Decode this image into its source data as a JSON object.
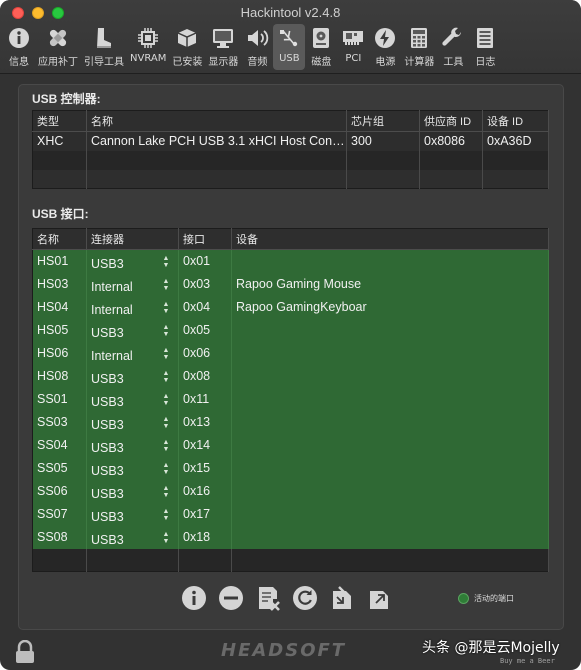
{
  "window": {
    "title": "Hackintool v2.4.8"
  },
  "toolbar": {
    "items": [
      {
        "label": "信息",
        "icon": "info-icon"
      },
      {
        "label": "应用补丁",
        "icon": "bandage-icon"
      },
      {
        "label": "引导工具",
        "icon": "boot-icon"
      },
      {
        "label": "NVRAM",
        "icon": "chip-icon"
      },
      {
        "label": "已安装",
        "icon": "box-icon"
      },
      {
        "label": "显示器",
        "icon": "monitor-icon"
      },
      {
        "label": "音频",
        "icon": "speaker-icon"
      },
      {
        "label": "USB",
        "icon": "usb-icon",
        "active": true
      },
      {
        "label": "磁盘",
        "icon": "disk-icon"
      },
      {
        "label": "PCI",
        "icon": "pci-card-icon"
      },
      {
        "label": "电源",
        "icon": "power-bolt-icon"
      },
      {
        "label": "计算器",
        "icon": "calculator-icon"
      },
      {
        "label": "工具",
        "icon": "wrench-icon"
      },
      {
        "label": "日志",
        "icon": "log-icon"
      }
    ]
  },
  "controllers": {
    "title": "USB 控制器:",
    "columns": [
      "类型",
      "名称",
      "芯片组",
      "供应商 ID",
      "设备 ID"
    ],
    "rows": [
      [
        "XHC",
        "Cannon Lake PCH USB 3.1 xHCI Host Controller",
        "300",
        "0x8086",
        "0xA36D"
      ]
    ]
  },
  "ports": {
    "title": "USB 接口:",
    "columns": [
      "名称",
      "连接器",
      "接口",
      "设备"
    ],
    "rows": [
      [
        "HS01",
        "USB3",
        "0x01",
        ""
      ],
      [
        "HS03",
        "Internal",
        "0x03",
        "Rapoo Gaming Mouse"
      ],
      [
        "HS04",
        "Internal",
        "0x04",
        "Rapoo GamingKeyboar"
      ],
      [
        "HS05",
        "USB3",
        "0x05",
        ""
      ],
      [
        "HS06",
        "Internal",
        "0x06",
        ""
      ],
      [
        "HS08",
        "USB3",
        "0x08",
        ""
      ],
      [
        "SS01",
        "USB3",
        "0x11",
        ""
      ],
      [
        "SS03",
        "USB3",
        "0x13",
        ""
      ],
      [
        "SS04",
        "USB3",
        "0x14",
        ""
      ],
      [
        "SS05",
        "USB3",
        "0x15",
        ""
      ],
      [
        "SS06",
        "USB3",
        "0x16",
        ""
      ],
      [
        "SS07",
        "USB3",
        "0x17",
        ""
      ],
      [
        "SS08",
        "USB3",
        "0x18",
        ""
      ]
    ]
  },
  "bottom_buttons": [
    "info-icon",
    "remove-icon",
    "clear-icon",
    "refresh-icon",
    "import-icon",
    "export-icon"
  ],
  "legend": {
    "label": "活动的端口",
    "color": "#2f7d37"
  },
  "footer": {
    "brand": "HEADSOFT",
    "watermark": "头条 @那是云Mojelly",
    "donate": "Buy me a Beer"
  },
  "colors": {
    "active_port_row": "#2f6934",
    "window_bg": "#323232"
  }
}
